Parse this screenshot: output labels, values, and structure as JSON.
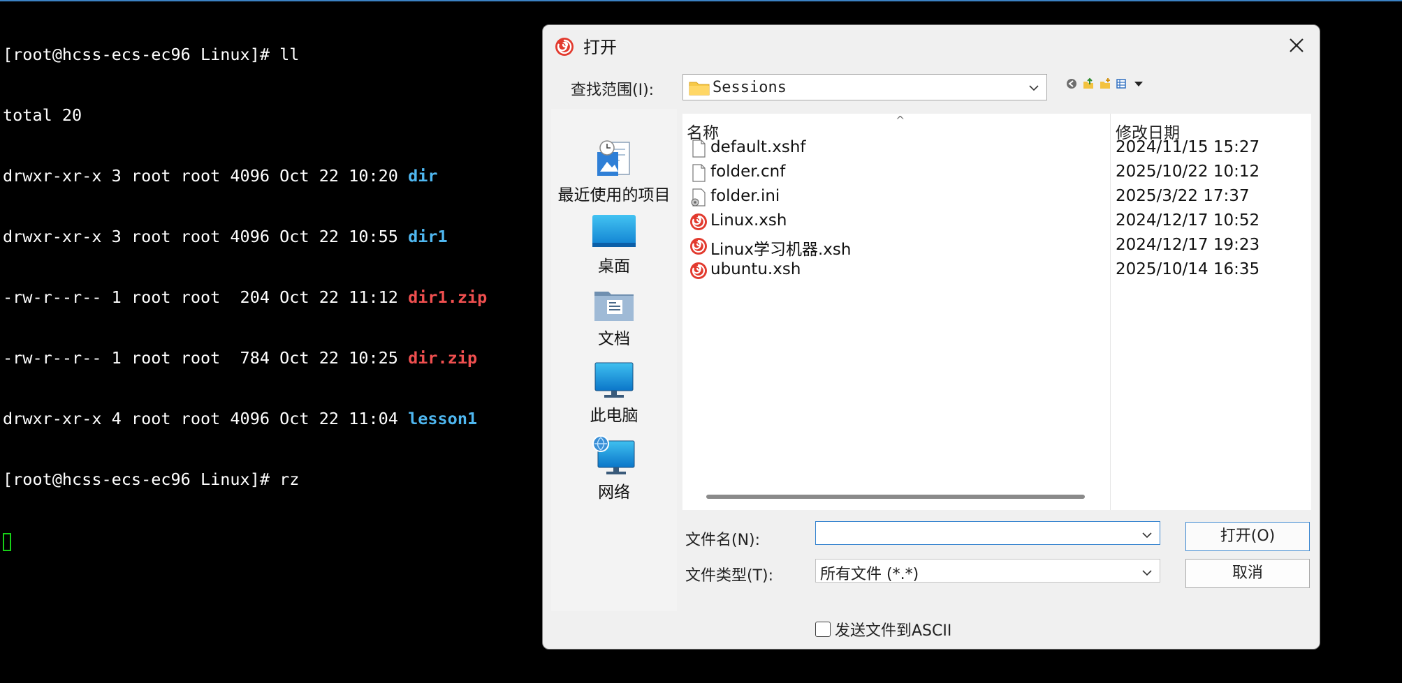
{
  "terminal": {
    "lines": [
      {
        "text": "[root@hcss-ecs-ec96 Linux]# ll"
      },
      {
        "text": "total 20"
      },
      {
        "prefix": "drwxr-xr-x 3 root root 4096 Oct 22 10:20 ",
        "name": "dir",
        "kind": "dir"
      },
      {
        "prefix": "drwxr-xr-x 3 root root 4096 Oct 22 10:55 ",
        "name": "dir1",
        "kind": "dir"
      },
      {
        "prefix": "-rw-r--r-- 1 root root  204 Oct 22 11:12 ",
        "name": "dir1.zip",
        "kind": "zip"
      },
      {
        "prefix": "-rw-r--r-- 1 root root  784 Oct 22 10:25 ",
        "name": "dir.zip",
        "kind": "zip"
      },
      {
        "prefix": "drwxr-xr-x 4 root root 4096 Oct 22 11:04 ",
        "name": "lesson1",
        "kind": "dir"
      },
      {
        "text": "[root@hcss-ecs-ec96 Linux]# rz"
      }
    ],
    "colors": {
      "dir": "#4fb7f0",
      "zip": "#ef4f4f",
      "cursor": "#17d017"
    }
  },
  "dialog": {
    "title": "打开",
    "look_in_label": "查找范围(I):",
    "look_in_value": "Sessions",
    "places": [
      {
        "label": "最近使用的项目",
        "icon": "recent-items-icon"
      },
      {
        "label": "桌面",
        "icon": "desktop-icon"
      },
      {
        "label": "文档",
        "icon": "documents-icon"
      },
      {
        "label": "此电脑",
        "icon": "this-pc-icon"
      },
      {
        "label": "网络",
        "icon": "network-icon"
      }
    ],
    "columns": {
      "name": "名称",
      "date": "修改日期"
    },
    "files": [
      {
        "name": "default.xshf",
        "date": "2024/11/15 15:27",
        "icon": "blank-file-icon"
      },
      {
        "name": "folder.cnf",
        "date": "2025/10/22 10:12",
        "icon": "blank-file-icon"
      },
      {
        "name": "folder.ini",
        "date": "2025/3/22 17:37",
        "icon": "settings-file-icon"
      },
      {
        "name": "Linux.xsh",
        "date": "2024/12/17 10:52",
        "icon": "xshell-session-icon"
      },
      {
        "name": "Linux学习机器.xsh",
        "date": "2024/12/17 19:23",
        "icon": "xshell-session-icon"
      },
      {
        "name": "ubuntu.xsh",
        "date": "2025/10/14 16:35",
        "icon": "xshell-session-icon"
      }
    ],
    "filename_label": "文件名(N):",
    "filename_value": "",
    "filetype_label": "文件类型(T):",
    "filetype_value": "所有文件 (*.*)",
    "open_button": "打开(O)",
    "cancel_button": "取消",
    "ascii_label": "发送文件到ASCII",
    "ascii_checked": false
  }
}
